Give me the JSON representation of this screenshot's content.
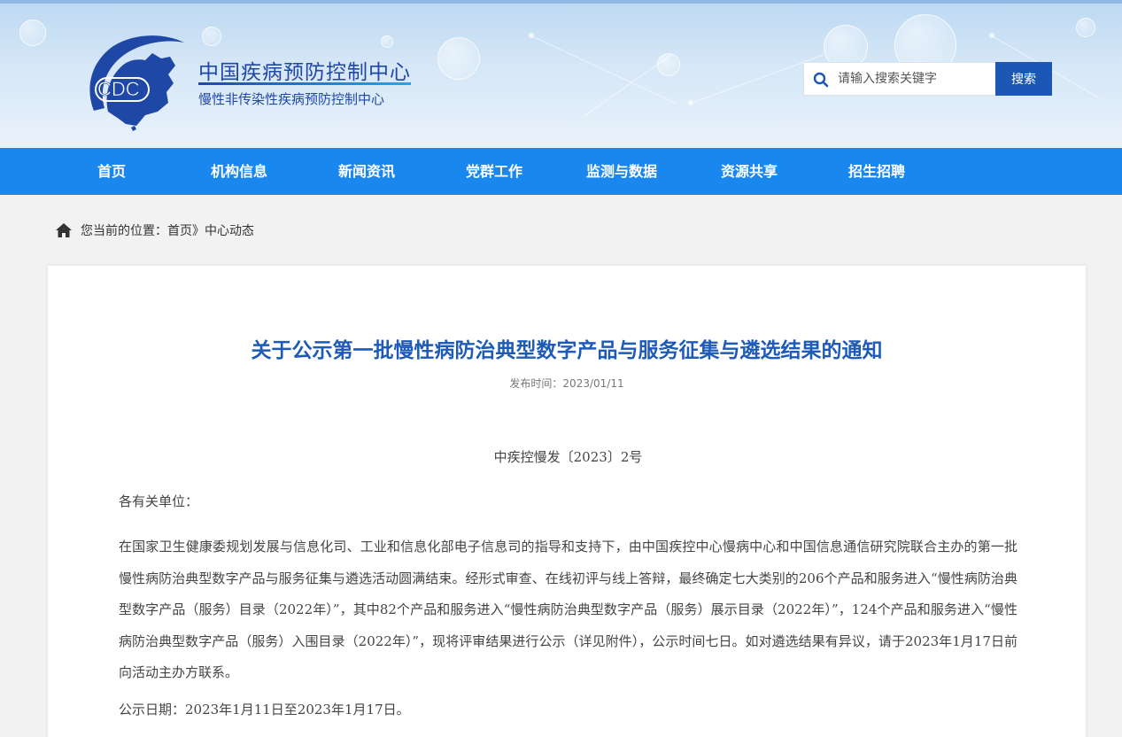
{
  "header": {
    "logo_text": "CDC",
    "org_name": "中国疾病预防控制中心",
    "sub_org_name": "慢性非传染性疾病预防控制中心",
    "search_placeholder": "请输入搜索关键字",
    "search_button": "搜索"
  },
  "nav": {
    "items": [
      {
        "label": "首页"
      },
      {
        "label": "机构信息"
      },
      {
        "label": "新闻资讯"
      },
      {
        "label": "党群工作"
      },
      {
        "label": "监测与数据"
      },
      {
        "label": "资源共享"
      },
      {
        "label": "招生招聘"
      }
    ]
  },
  "breadcrumb": {
    "prefix": "您当前的位置：",
    "home": "首页",
    "separator": "》",
    "current": "中心动态"
  },
  "article": {
    "title": "关于公示第一批慢性病防治典型数字产品与服务征集与遴选结果的通知",
    "date_label": "发布时间：",
    "date": "2023/01/11",
    "doc_number": "中疾控慢发〔2023〕2号",
    "salutation": "各有关单位：",
    "paragraph": "在国家卫生健康委规划发展与信息化司、工业和信息化部电子信息司的指导和支持下，由中国疾控中心慢病中心和中国信息通信研究院联合主办的第一批慢性病防治典型数字产品与服务征集与遴选活动圆满结束。经形式审查、在线初评与线上答辩，最终确定七大类别的206个产品和服务进入“慢性病防治典型数字产品（服务）目录（2022年）”，其中82个产品和服务进入“慢性病防治典型数字产品（服务）展示目录（2022年）”，124个产品和服务进入“慢性病防治典型数字产品（服务）入围目录（2022年）”，现将评审结果进行公示（详见附件），公示时间七日。如对遴选结果有异议，请于2023年1月17日前向活动主办方联系。",
    "publicity_dates": "公示日期：2023年1月11日至2023年1月17日。"
  },
  "colors": {
    "nav_bg": "#1a87ef",
    "title_blue": "#1e5bb8",
    "brand_blue": "#1f48a6",
    "search_button_bg": "#1d57b5"
  },
  "icons": {
    "search": "search-icon",
    "home": "home-icon",
    "logo": "cdc-logo-icon"
  }
}
